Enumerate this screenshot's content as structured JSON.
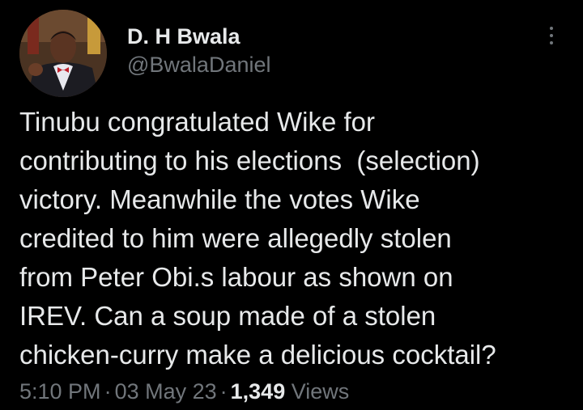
{
  "author": {
    "display_name": "D. H Bwala",
    "handle": "@BwalaDaniel"
  },
  "icons": {
    "more": "more-vertical-icon"
  },
  "tweet": {
    "text": "Tinubu congratulated Wike for\ncontributing to his elections  (selection)\nvictory. Meanwhile the votes Wike\ncredited to him were allegedly stolen\nfrom Peter Obi.s labour as shown on\nIREV. Can a soup made of a stolen\nchicken-curry make a delicious cocktail?"
  },
  "meta": {
    "time": "5:10 PM",
    "separator": "·",
    "date": "03 May 23",
    "views_count": "1,349",
    "views_label": "Views"
  },
  "colors": {
    "background": "#000000",
    "primary_text": "#e7e9ea",
    "secondary_text": "#71767b"
  }
}
